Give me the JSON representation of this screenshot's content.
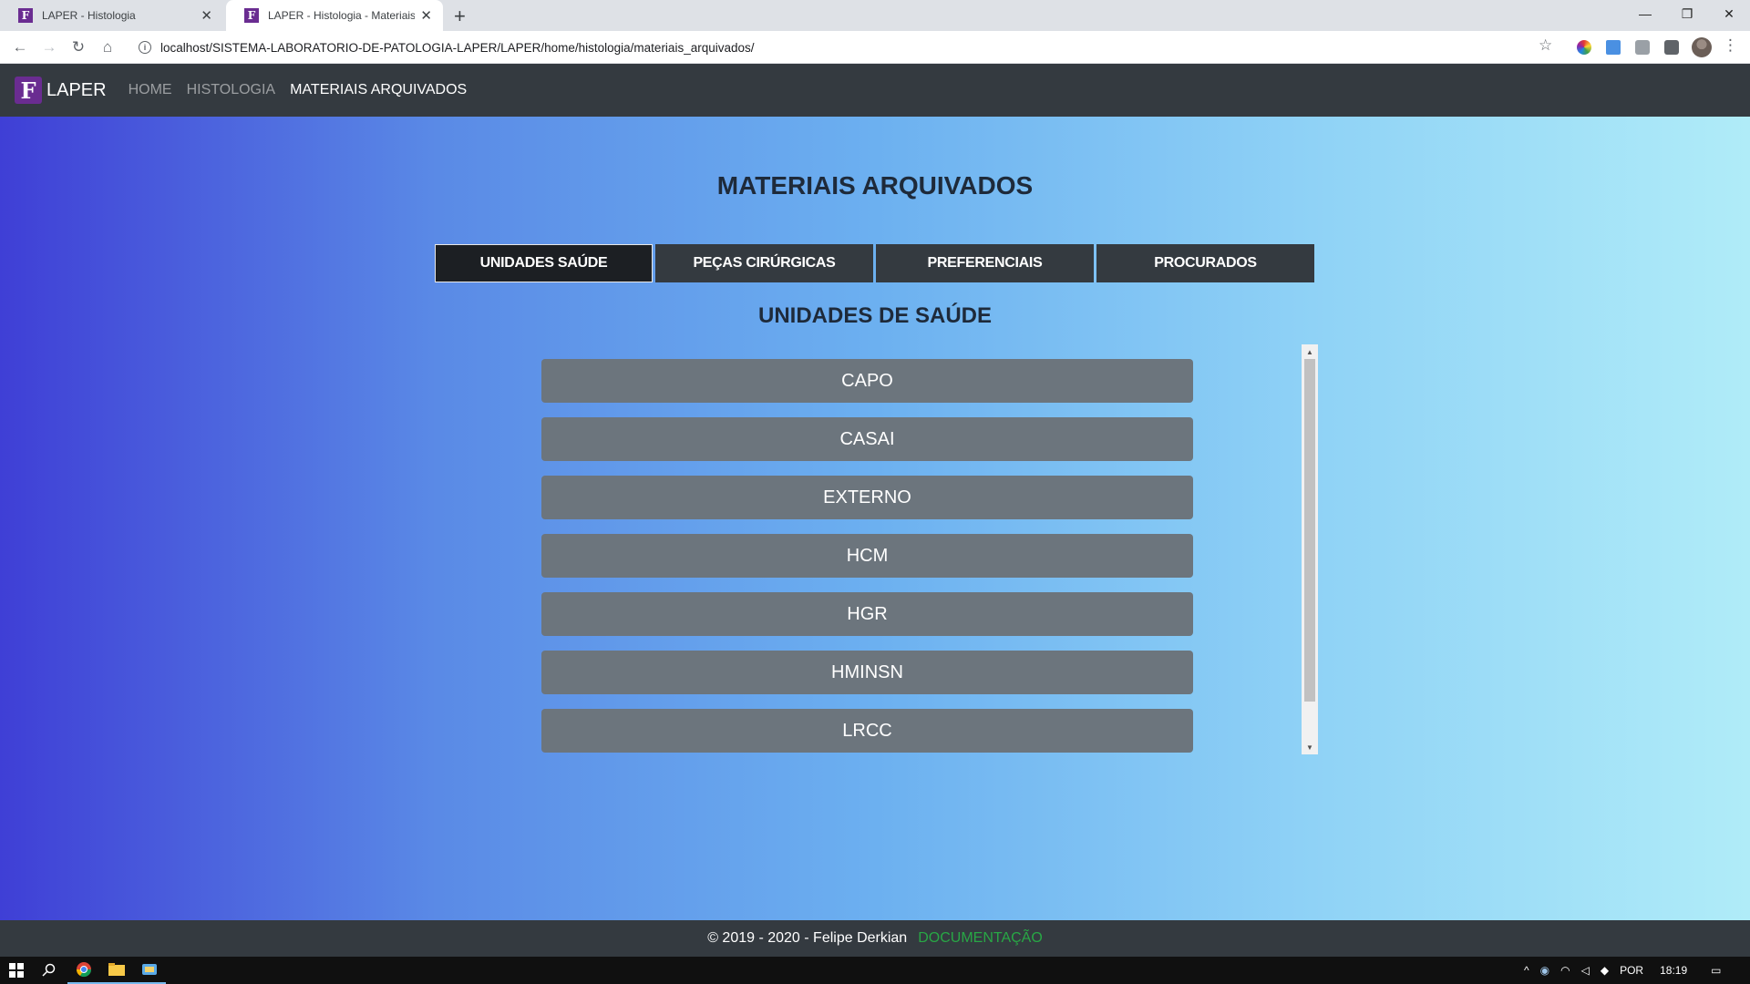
{
  "browser": {
    "tabs": [
      {
        "title": "LAPER - Histologia",
        "favicon": "F"
      },
      {
        "title": "LAPER - Histologia - Materiais ar",
        "favicon": "F"
      }
    ],
    "url": "localhost/SISTEMA-LABORATORIO-DE-PATOLOGIA-LAPER/LAPER/home/histologia/materiais_arquivados/"
  },
  "navbar": {
    "logo_letter": "F",
    "brand": "LAPER",
    "links": [
      "HOME",
      "HISTOLOGIA",
      "MATERIAIS ARQUIVADOS"
    ],
    "active_index": 2
  },
  "page": {
    "title": "MATERIAIS ARQUIVADOS",
    "tabs": [
      "UNIDADES SAÚDE",
      "PEÇAS CIRÚRGICAS",
      "PREFERENCIAIS",
      "PROCURADOS"
    ],
    "active_tab": 0,
    "section_title": "UNIDADES DE SAÚDE",
    "units": [
      "CAPO",
      "CASAI",
      "EXTERNO",
      "HCM",
      "HGR",
      "HMINSN",
      "LRCC"
    ]
  },
  "footer": {
    "copyright": "© 2019 - 2020 - Felipe Derkian",
    "doc_link": "DOCUMENTAÇÃO"
  },
  "taskbar": {
    "language": "POR",
    "time": "18:19"
  },
  "colors": {
    "navbar_bg": "#343a40",
    "unit_button_bg": "#6c757d",
    "doc_link": "#28a745",
    "brand_purple": "#6a2c91"
  }
}
